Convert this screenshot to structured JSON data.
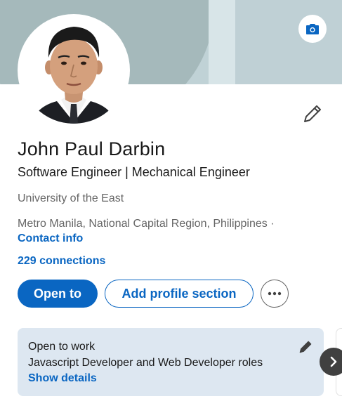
{
  "profile": {
    "name": "John Paul Darbin",
    "headline": "Software Engineer | Mechanical Engineer",
    "education": "University of the East",
    "location": "Metro Manila, National Capital Region, Philippines ·",
    "contact_info_label": "Contact info",
    "connections_label": "229 connections"
  },
  "actions": {
    "open_to_label": "Open to",
    "add_section_label": "Add profile section",
    "more_icon": "ellipsis-icon"
  },
  "open_to_work": {
    "title": "Open to work",
    "roles": "Javascript Developer and Web Developer roles",
    "show_details_label": "Show details"
  },
  "icons": {
    "cover_camera": "camera-icon",
    "edit_intro": "pencil-icon",
    "carousel_next": "chevron-right-icon"
  },
  "colors": {
    "brand_blue": "#0a66c2",
    "card_background": "#dde7f1",
    "secondary_text": "#666666"
  }
}
